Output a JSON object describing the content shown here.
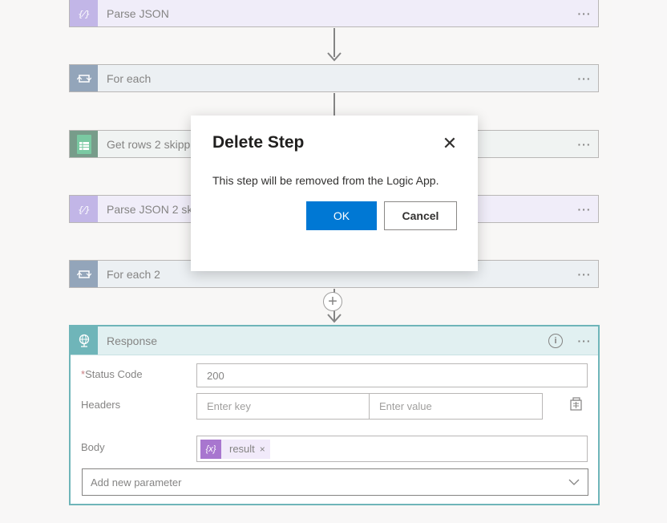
{
  "steps": [
    {
      "title": "Parse JSON",
      "icon": "braces-icon"
    },
    {
      "title": "For each",
      "icon": "loop-icon"
    },
    {
      "title": "Get rows 2 skipp",
      "icon": "spreadsheet-icon"
    },
    {
      "title": "Parse JSON 2 ski",
      "icon": "braces-icon"
    },
    {
      "title": "For each 2",
      "icon": "loop-icon"
    }
  ],
  "more_label": "···",
  "add_step_symbol": "+",
  "response": {
    "title": "Response",
    "info_symbol": "i",
    "status_code_label": "Status Code",
    "required_marker": "*",
    "status_code_value": "200",
    "headers_label": "Headers",
    "key_placeholder": "Enter key",
    "value_placeholder": "Enter value",
    "body_label": "Body",
    "token_symbol": "{x}",
    "token_label": "result",
    "token_remove": "×",
    "add_param_label": "Add new parameter"
  },
  "dialog": {
    "title": "Delete Step",
    "close_symbol": "✕",
    "message": "This step will be removed from the Logic App.",
    "ok_label": "OK",
    "cancel_label": "Cancel"
  },
  "colors": {
    "primary": "#0078d4",
    "response_accent": "#10848b",
    "parse_accent": "#9a86d8",
    "loop_accent": "#4c6a8c",
    "sheets_accent": "#1d5b3c",
    "token_accent": "#6e1cb0"
  }
}
